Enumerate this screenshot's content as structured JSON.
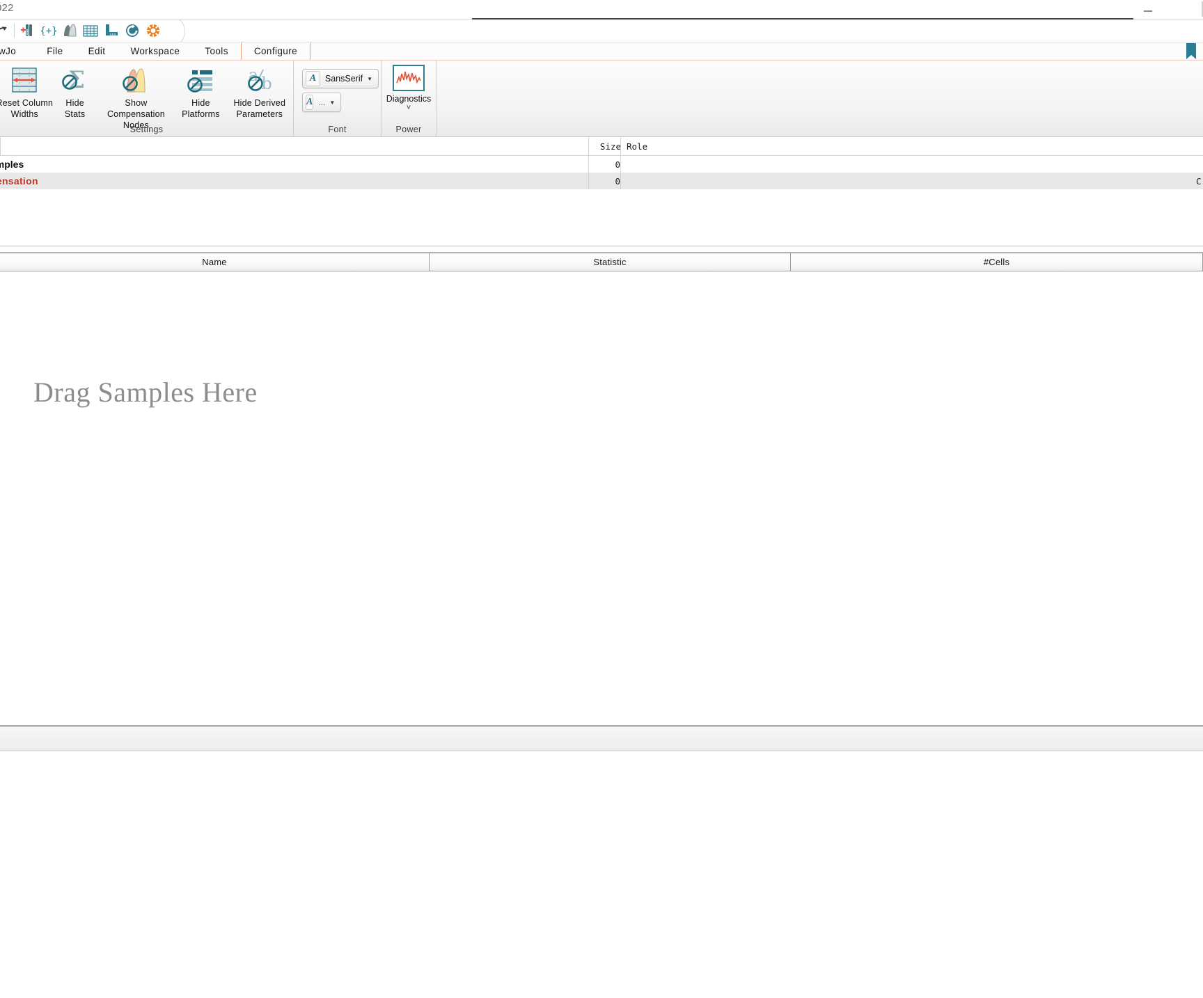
{
  "window": {
    "title": "022",
    "minimize_label": "minimize"
  },
  "quick_toolbar": {
    "items": [
      {
        "name": "redo-icon",
        "label": "Redo"
      },
      {
        "name": "add-samples-icon",
        "label": "Add Samples"
      },
      {
        "name": "add-group-icon",
        "label": "Add Group"
      },
      {
        "name": "compensation-icon",
        "label": "Compensation"
      },
      {
        "name": "table-editor-icon",
        "label": "Table Editor"
      },
      {
        "name": "layout-editor-icon",
        "label": "Layout Editor"
      },
      {
        "name": "refresh-icon",
        "label": "Refresh"
      },
      {
        "name": "plugin-icon",
        "label": "Plugins"
      }
    ]
  },
  "menubar": {
    "items": [
      {
        "label": "wJo",
        "active": false
      },
      {
        "label": "File",
        "active": false
      },
      {
        "label": "Edit",
        "active": false
      },
      {
        "label": "Workspace",
        "active": false
      },
      {
        "label": "Tools",
        "active": false
      },
      {
        "label": "Configure",
        "active": true
      }
    ],
    "bookmark_icon": "bookmark-icon"
  },
  "ribbon": {
    "groups": [
      {
        "label": "Settings",
        "buttons": [
          {
            "caption_line1": "Reset Column",
            "caption_line2": "Widths",
            "icon": "reset-column-widths-icon"
          },
          {
            "caption_line1": "Hide",
            "caption_line2": "Stats",
            "icon": "hide-stats-icon"
          },
          {
            "caption_line1": "Show Compensation",
            "caption_line2": "Nodes",
            "icon": "show-compensation-nodes-icon"
          },
          {
            "caption_line1": "Hide",
            "caption_line2": "Platforms",
            "icon": "hide-platforms-icon"
          },
          {
            "caption_line1": "Hide Derived",
            "caption_line2": "Parameters",
            "icon": "hide-derived-parameters-icon"
          }
        ]
      },
      {
        "label": "Font",
        "font_family_value": "SansSerif",
        "font_size_value": "...",
        "font_family_icon": "font-letter-icon",
        "font_size_icon": "font-size-letter-icon"
      },
      {
        "label": "Power",
        "diagnostics_label": "Diagnostics",
        "diagnostics_icon": "diagnostics-waveform-icon"
      }
    ]
  },
  "group_table": {
    "columns": [
      "",
      "Size",
      "Role"
    ],
    "rows": [
      {
        "name": "amples",
        "size": "0",
        "role": "",
        "selected": false,
        "alt": false
      },
      {
        "name": "pensation",
        "size": "0",
        "role": "C",
        "selected": true,
        "alt": true
      }
    ]
  },
  "samples_pane": {
    "columns": [
      "Name",
      "Statistic",
      "#Cells"
    ],
    "drop_hint": "Drag Samples Here"
  },
  "colors": {
    "teal": "#2e7d8f",
    "orange": "#e8711a",
    "red_text": "#c0392b",
    "ribbon_bg": "#f4f4f4",
    "selected_row": "#e8e8e8",
    "drag_text": "#8c8c8c"
  }
}
